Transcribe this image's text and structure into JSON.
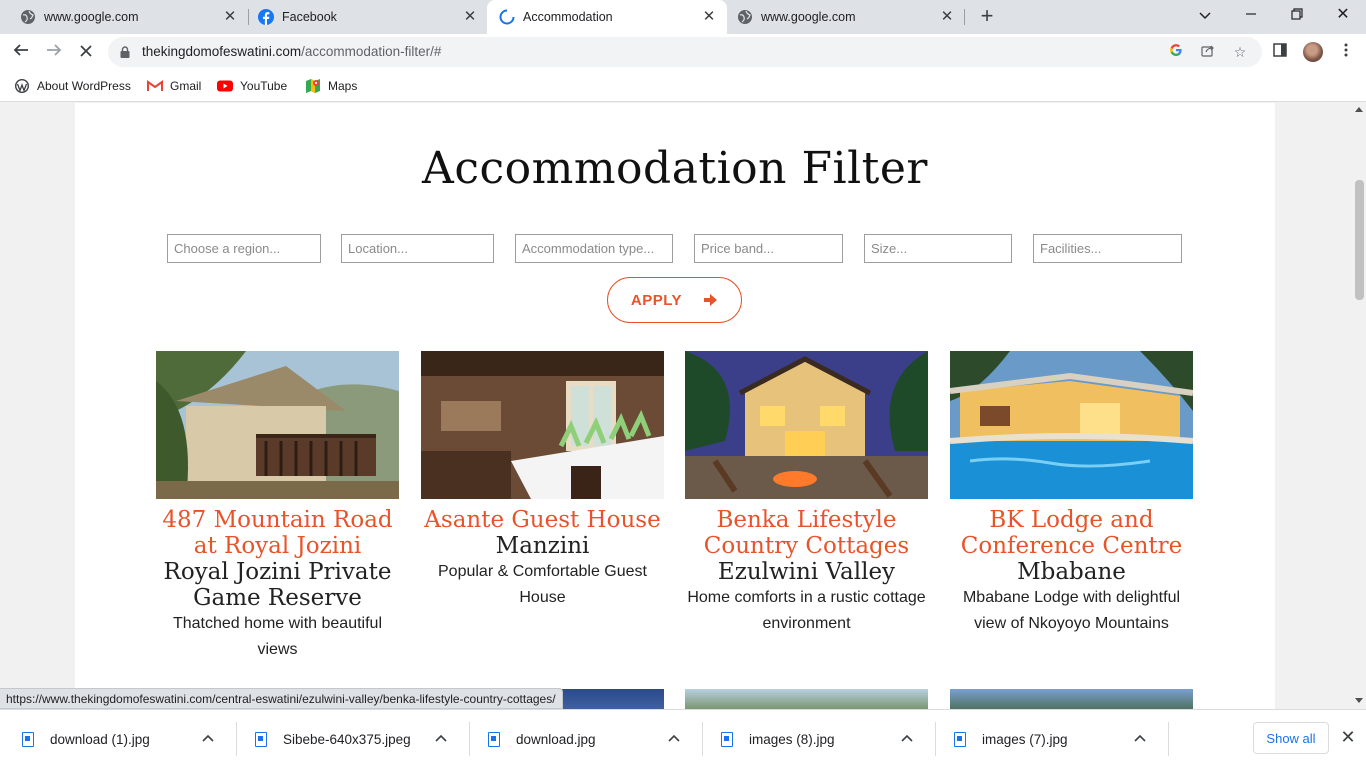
{
  "browser": {
    "tabs": [
      {
        "title": "www.google.com",
        "icon": "globe-icon",
        "active": false
      },
      {
        "title": "Facebook",
        "icon": "facebook-icon",
        "active": false
      },
      {
        "title": "Accommodation",
        "icon": "loading-icon",
        "active": true
      },
      {
        "title": "www.google.com",
        "icon": "globe-icon",
        "active": false
      }
    ],
    "url_domain": "thekingdomofeswatini.com",
    "url_path": "/accommodation-filter/#",
    "bookmarks": [
      {
        "label": "About WordPress",
        "icon": "wordpress-icon"
      },
      {
        "label": "Gmail",
        "icon": "gmail-icon"
      },
      {
        "label": "YouTube",
        "icon": "youtube-icon"
      },
      {
        "label": "Maps",
        "icon": "maps-icon"
      }
    ]
  },
  "page": {
    "title": "Accommodation Filter",
    "filters": [
      {
        "placeholder": "Choose a region..."
      },
      {
        "placeholder": "Location..."
      },
      {
        "placeholder": "Accommodation type..."
      },
      {
        "placeholder": "Price band..."
      },
      {
        "placeholder": "Size..."
      },
      {
        "placeholder": "Facilities..."
      }
    ],
    "apply_label": "APPLY",
    "accent_color": "#e8532a",
    "listings": [
      {
        "title": "487 Mountain Road at Royal Jozini",
        "location": "Royal Jozini Private Game Reserve",
        "description": "Thatched home with beautiful views"
      },
      {
        "title": "Asante Guest House",
        "location": "Manzini",
        "description": "Popular & Comfortable Guest House"
      },
      {
        "title": "Benka Lifestyle Country Cottages",
        "location": "Ezulwini Valley",
        "description": "Home comforts in a rustic cottage environment"
      },
      {
        "title": "BK Lodge and Conference Centre",
        "location": "Mbabane",
        "description": "Mbabane Lodge with delightful view of Nkoyoyo Mountains"
      }
    ]
  },
  "status_url": "https://www.thekingdomofeswatini.com/central-eswatini/ezulwini-valley/benka-lifestyle-country-cottages/",
  "downloads": {
    "items": [
      {
        "name": "download (1).jpg"
      },
      {
        "name": "Sibebe-640x375.jpeg"
      },
      {
        "name": "download.jpg"
      },
      {
        "name": "images (8).jpg"
      },
      {
        "name": "images (7).jpg"
      }
    ],
    "show_all_label": "Show all"
  }
}
